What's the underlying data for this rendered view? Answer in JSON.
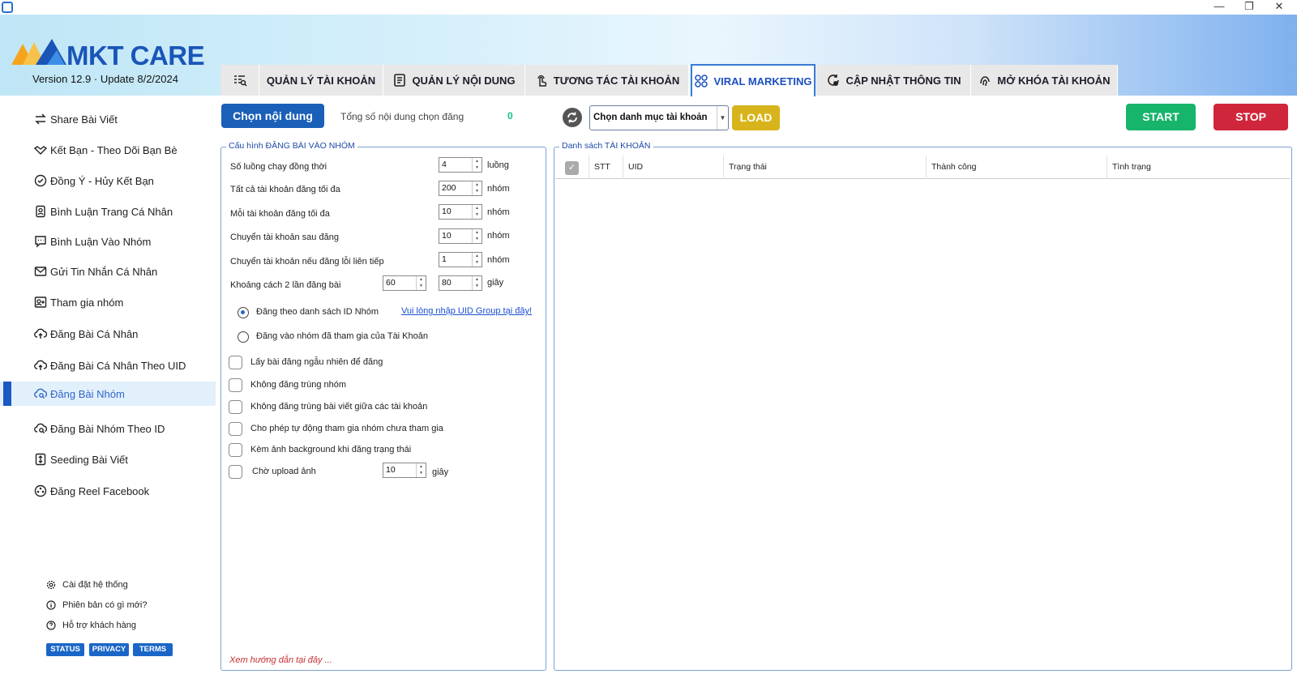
{
  "window": {
    "minimize": "—",
    "restore": "❐",
    "close": "✕"
  },
  "brand": {
    "name": "MKT CARE",
    "version": "Version  12.9 · Update  8/2/2024"
  },
  "tabs": [
    {
      "label": "QUẢN LÝ TÀI KHOẢN",
      "icon": "account-list-icon"
    },
    {
      "label": "QUẢN LÝ NỘI DUNG",
      "icon": "content-icon"
    },
    {
      "label": "TƯƠNG TÁC TÀI KHOẢN",
      "icon": "hand-tap-icon"
    },
    {
      "label": "VIRAL MARKETING",
      "icon": "viral-grid-icon",
      "active": true
    },
    {
      "label": "CẬP NHẬT THÔNG TIN",
      "icon": "update-icon"
    },
    {
      "label": "MỞ KHÓA TÀI KHOẢN",
      "icon": "fingerprint-icon"
    }
  ],
  "sidebar": {
    "items": [
      {
        "label": "Share Bài Viết"
      },
      {
        "label": "Kết Bạn - Theo Dõi Bạn Bè"
      },
      {
        "label": "Đồng Ý - Hủy Kết Bạn"
      },
      {
        "label": "Bình Luận Trang Cá Nhân"
      },
      {
        "label": "Bình Luận Vào Nhóm"
      },
      {
        "label": "Gửi Tin Nhắn Cá Nhân"
      },
      {
        "label": "Tham gia nhóm"
      },
      {
        "label": "Đăng Bài Cá Nhân"
      },
      {
        "label": "Đăng Bài Cá Nhân Theo UID"
      },
      {
        "label": "Đăng Bài Nhóm",
        "active": true
      },
      {
        "label": "Đăng Bài Nhóm Theo ID"
      },
      {
        "label": "Seeding Bài Viết"
      },
      {
        "label": "Đăng Reel Facebook"
      }
    ],
    "footer": [
      {
        "label": "Cài đặt hệ thống"
      },
      {
        "label": "Phiên bản có gì mới?"
      },
      {
        "label": "Hỗ trợ khách hàng"
      }
    ],
    "pills": [
      "STATUS",
      "PRIVACY",
      "TERMS"
    ]
  },
  "toolbar": {
    "choose_content": "Chọn nội dung",
    "total_label": "Tổng số nội dung chọn đăng",
    "total_value": "0",
    "category_select": "Chọn danh mục tài khoản",
    "load": "LOAD",
    "start": "START",
    "stop": "STOP"
  },
  "config": {
    "title": "Cấu hình ĐĂNG BÀI VÀO NHÓM",
    "fields": [
      {
        "label": "Số luồng chạy đồng thời",
        "value": "4",
        "unit": "luồng"
      },
      {
        "label": "Tất cả tài khoản đăng tối đa",
        "value": "200",
        "unit": "nhóm"
      },
      {
        "label": "Mỗi tài khoản đăng tối đa",
        "value": "10",
        "unit": "nhóm"
      },
      {
        "label": "Chuyển tài khoản sau đăng",
        "value": "10",
        "unit": "nhóm"
      },
      {
        "label": "Chuyển tài khoản nếu đăng lỗi liên tiếp",
        "value": "1",
        "unit": "nhóm"
      }
    ],
    "interval": {
      "label": "Khoảng cách 2 lần đăng bài",
      "min": "60",
      "max": "80",
      "unit": "giây"
    },
    "radios": [
      {
        "label": "Đăng theo danh sách ID Nhóm",
        "checked": true
      },
      {
        "label": "Đăng vào nhóm đã tham gia của Tài Khoản",
        "checked": false
      }
    ],
    "group_link": "Vui lòng nhập UID Group tại đây!",
    "checkboxes": [
      {
        "label": "Lấy bài đăng ngẫu nhiên để đăng",
        "checked": false
      },
      {
        "label": "Không đăng trùng nhóm",
        "checked": false
      },
      {
        "label": "Không đăng trùng bài viết giữa các tài khoản",
        "checked": false
      },
      {
        "label": "Cho phép tự động tham gia nhóm chưa tham gia",
        "checked": false
      },
      {
        "label": "Kèm ảnh background khi đăng trạng thái",
        "checked": false
      }
    ],
    "upload_wait": {
      "label": "Chờ upload ảnh",
      "value": "10",
      "unit": "giây"
    },
    "guide_link": "Xem hướng dẫn tại đây ..."
  },
  "accounts": {
    "title": "Danh sách TÀI KHOẢN",
    "columns": [
      "STT",
      "UID",
      "Trạng thái",
      "Thành công",
      "Tình trạng"
    ]
  }
}
